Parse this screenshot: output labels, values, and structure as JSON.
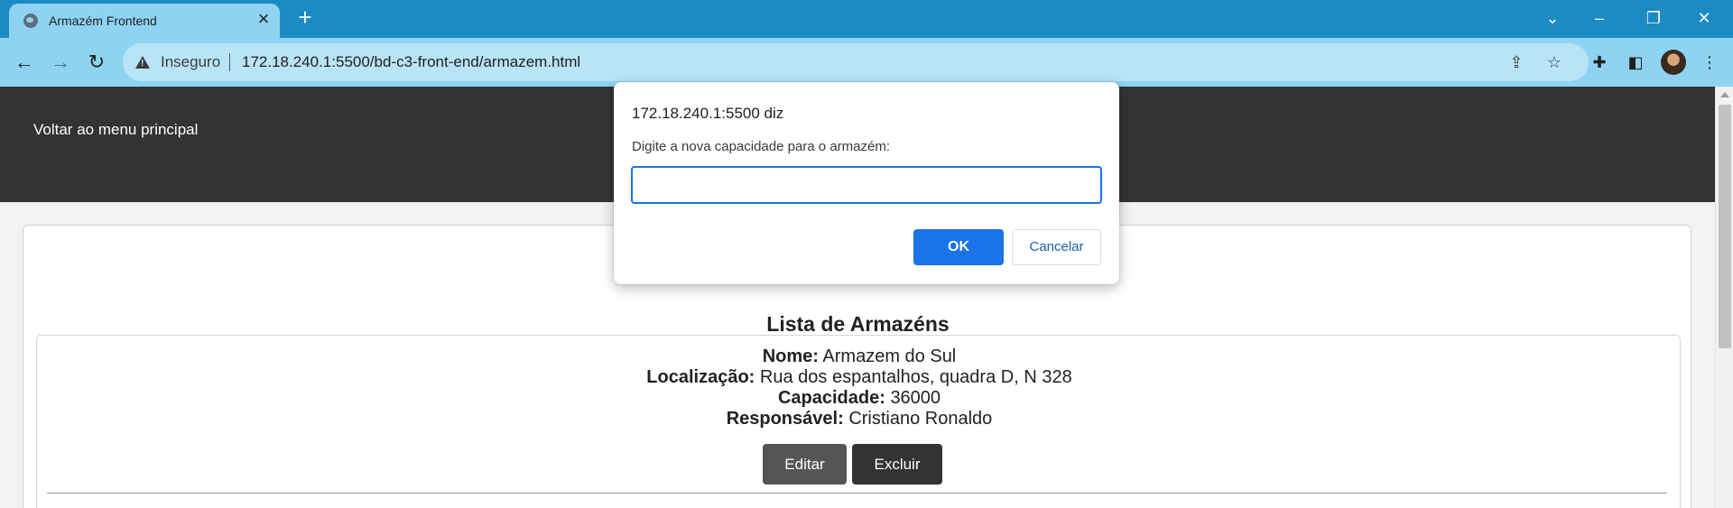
{
  "browser": {
    "tab": {
      "title": "Armazém Frontend",
      "favicon": "globe-icon"
    },
    "new_tab_glyph": "+",
    "window_controls": {
      "minimize": "chevron-down-icon",
      "restore": "restore-icon",
      "close": "close-icon"
    },
    "address_bar": {
      "security_label": "Inseguro",
      "url": "172.18.240.1:5500/bd-c3-front-end/armazem.html"
    },
    "colors": {
      "tabbar": "#1a8bc4",
      "toolbar": "#8fd3f2"
    }
  },
  "page": {
    "header": {
      "back_link": "Voltar ao menu principal"
    },
    "list_title": "Lista de Armazéns",
    "items": [
      {
        "nome_label": "Nome:",
        "nome": "Armazem do Sul",
        "localizacao_label": "Localização:",
        "localizacao": "Rua dos espantalhos, quadra D, N 328",
        "capacidade_label": "Capacidade:",
        "capacidade": "36000",
        "responsavel_label": "Responsável:",
        "responsavel": "Cristiano Ronaldo",
        "edit_label": "Editar",
        "delete_label": "Excluir"
      }
    ]
  },
  "dialog": {
    "origin": "172.18.240.1:5500 diz",
    "message": "Digite a nova capacidade para o armazém:",
    "input_value": "",
    "ok_label": "OK",
    "cancel_label": "Cancelar",
    "accent": "#1a73e8"
  }
}
